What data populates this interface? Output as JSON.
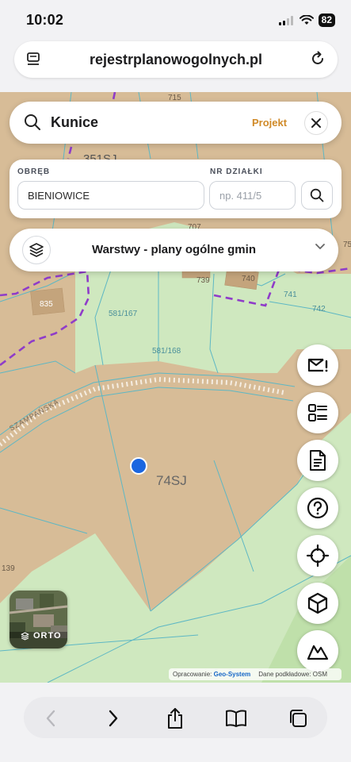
{
  "status": {
    "time": "10:02",
    "battery": "82"
  },
  "browser": {
    "url": "rejestrplanowogolnych.pl"
  },
  "search": {
    "query": "Kunice",
    "badge": "Projekt"
  },
  "parcel_form": {
    "obreb_label": "OBRĘB",
    "obreb_value": "BIENIOWICE",
    "dzialka_label": "NR DZIAŁKI",
    "dzialka_placeholder": "np. 411/5"
  },
  "layers": {
    "label": "Warstwy - plany ogólne gmin"
  },
  "map": {
    "labels": {
      "l715": "715",
      "l351sj": "351SJ",
      "l707": "707",
      "l739": "739",
      "l740": "740",
      "l741": "741",
      "l742": "742",
      "l75": "75",
      "l835": "835",
      "l581_167": "581/167",
      "l581_168": "581/168",
      "street": "SZAMPAŃSKA",
      "zone": "74SJ",
      "l139": "139"
    },
    "colors": {
      "residential": "#d7bc97",
      "green": "#cfe8bf",
      "green_dark": "#bfe0aa",
      "boundary": "#8f3cc9",
      "parcel_line": "#5db7c4",
      "location_dot": "#1a66e0"
    }
  },
  "side_buttons": [
    {
      "name": "mail-alert-icon"
    },
    {
      "name": "list-icon"
    },
    {
      "name": "document-icon"
    },
    {
      "name": "help-icon"
    },
    {
      "name": "locate-icon"
    },
    {
      "name": "cube-icon"
    },
    {
      "name": "terrain-icon"
    }
  ],
  "orto": {
    "label": "ORTO"
  },
  "attribution": {
    "prefix": "Opracowanie:",
    "brand": "Geo-System",
    "base": "Dane podkładowe: OSM"
  }
}
